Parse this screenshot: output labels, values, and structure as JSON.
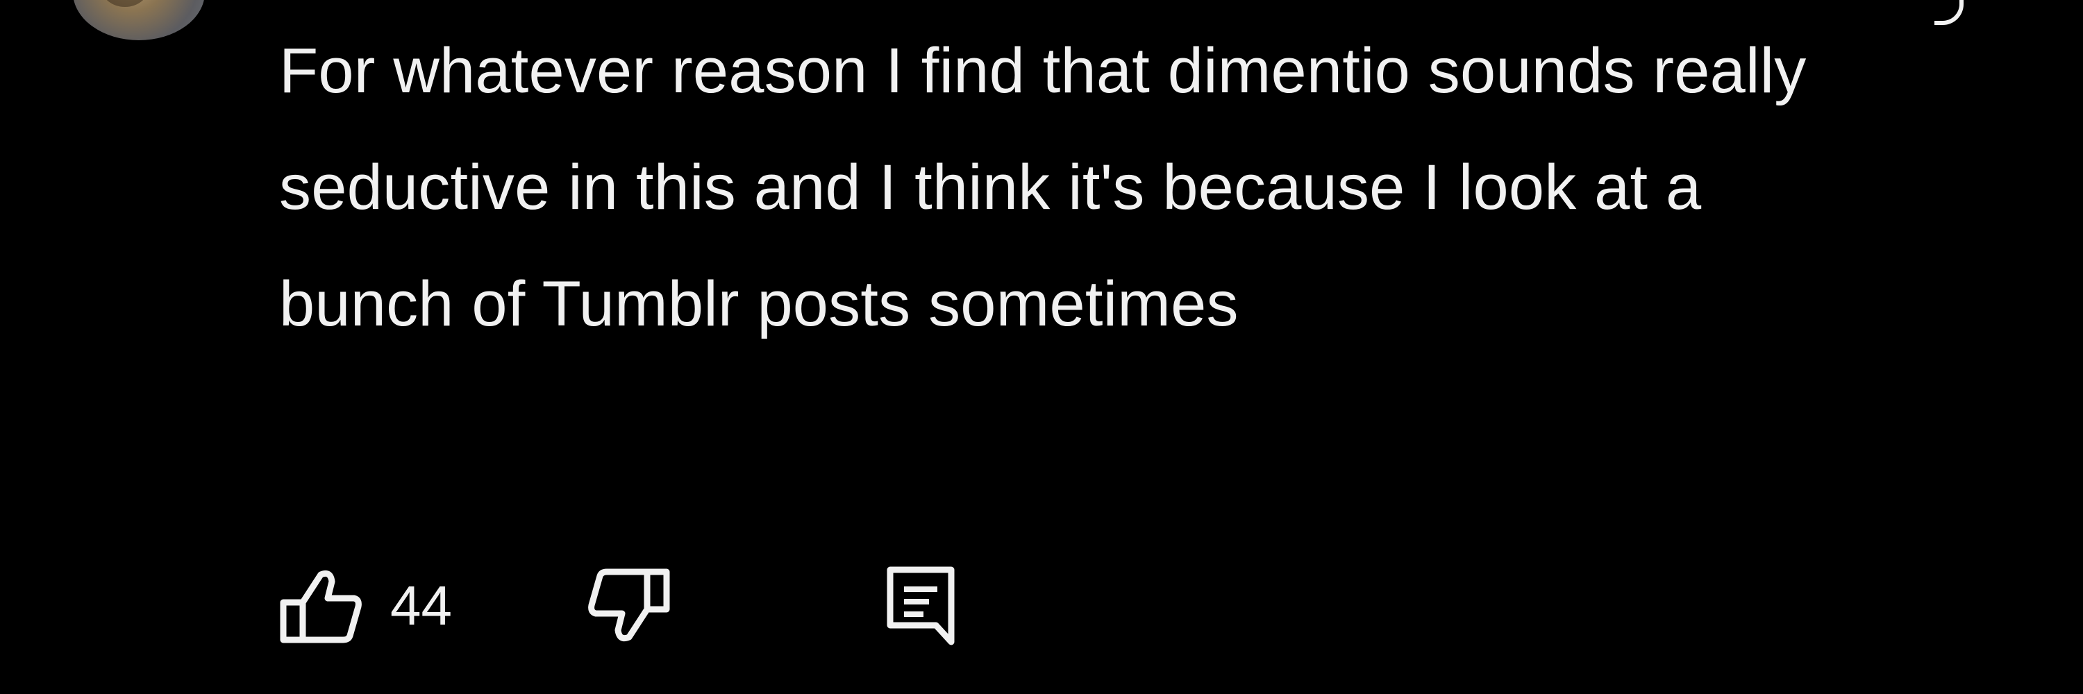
{
  "comment": {
    "avatar_icon": "user-avatar",
    "text": "For whatever reason I find that dimentio sounds really seductive in this and I think it's because I look at a bunch of Tumblr posts sometimes"
  },
  "actions": {
    "like_icon": "thumbs-up-icon",
    "like_count": "44",
    "dislike_icon": "thumbs-down-icon",
    "reply_icon": "comment-reply-icon"
  },
  "colors": {
    "background": "#000000",
    "text": "#f1f1f1"
  }
}
